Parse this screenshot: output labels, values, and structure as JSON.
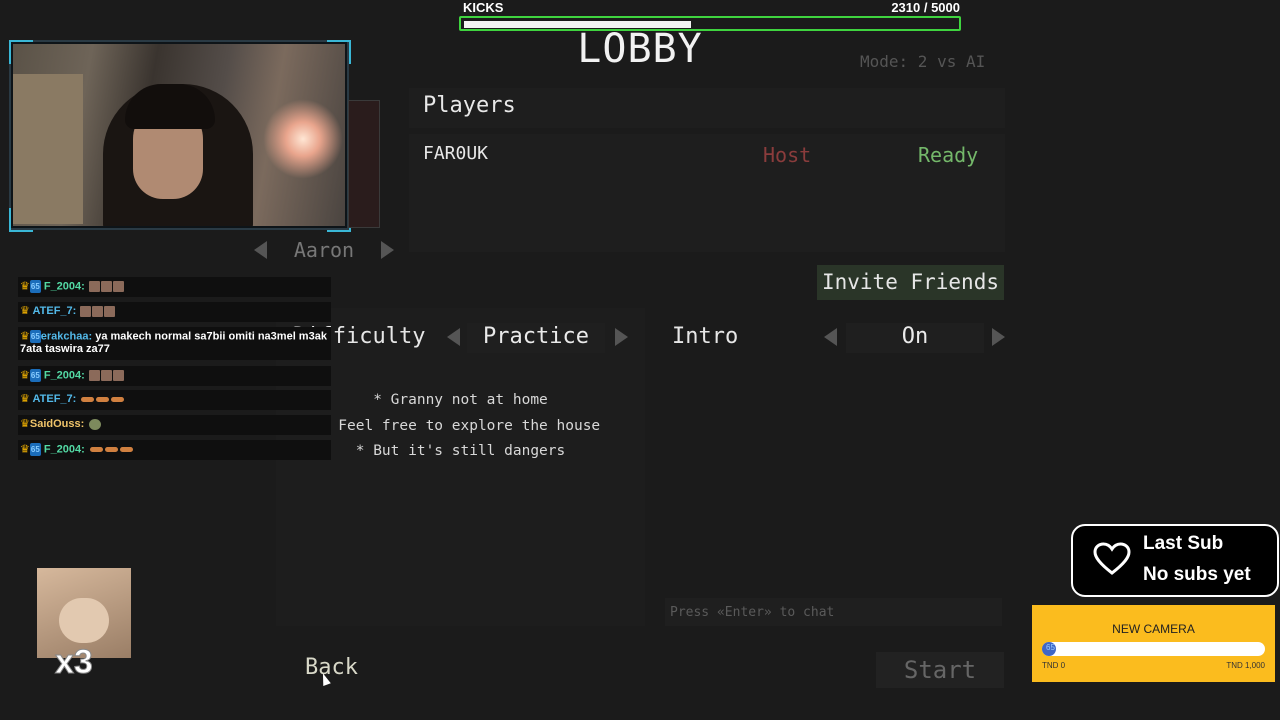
{
  "kicks": {
    "label": "KICKS",
    "current": 2310,
    "goal": 5000,
    "count_text": "2310  / 5000"
  },
  "lobby": {
    "title": "LOBBY",
    "mode": "Mode:  2 vs AI",
    "players_title": "Players",
    "players": [
      {
        "name": "FAR0UK",
        "role": "Host",
        "status": "Ready"
      }
    ],
    "character": "Aaron",
    "invite_label": "Invite Friends",
    "difficulty_label": "Difficulty",
    "difficulty_value": "Practice",
    "intro_label": "Intro",
    "intro_value": "On",
    "description": [
      "* Granny not at home",
      "* Feel free to explore the house",
      "* But it's still dangers"
    ],
    "chat_placeholder": "Press «Enter» to chat",
    "back_label": "Back",
    "start_label": "Start"
  },
  "stream_chat": [
    {
      "user": "F_2004:",
      "text": ""
    },
    {
      "user": "ATEF_7:",
      "text": ""
    },
    {
      "user": "erakchaa:",
      "text": "ya makech normal sa7bii omiti na3mel m3ak 7ata taswira za77"
    },
    {
      "user": "F_2004:",
      "text": ""
    },
    {
      "user": "ATEF_7:",
      "text": ""
    },
    {
      "user": "SaidOuss:",
      "text": ""
    },
    {
      "user": "F_2004:",
      "text": ""
    }
  ],
  "cat_widget": {
    "multiplier": "x3"
  },
  "last_sub": {
    "title": "Last Sub",
    "value": "No subs yet"
  },
  "goal": {
    "title": "NEW CAMERA",
    "progress_label": "65",
    "min_label": "TND 0",
    "max_label": "TND 1,000",
    "current": 65,
    "max": 1000
  },
  "colors": {
    "kicks_border": "#3fd43f",
    "host": "#8a3c3c",
    "ready": "#74b86a",
    "goal_bg": "#fbbc1e",
    "goal_fill": "#3f66c5"
  }
}
